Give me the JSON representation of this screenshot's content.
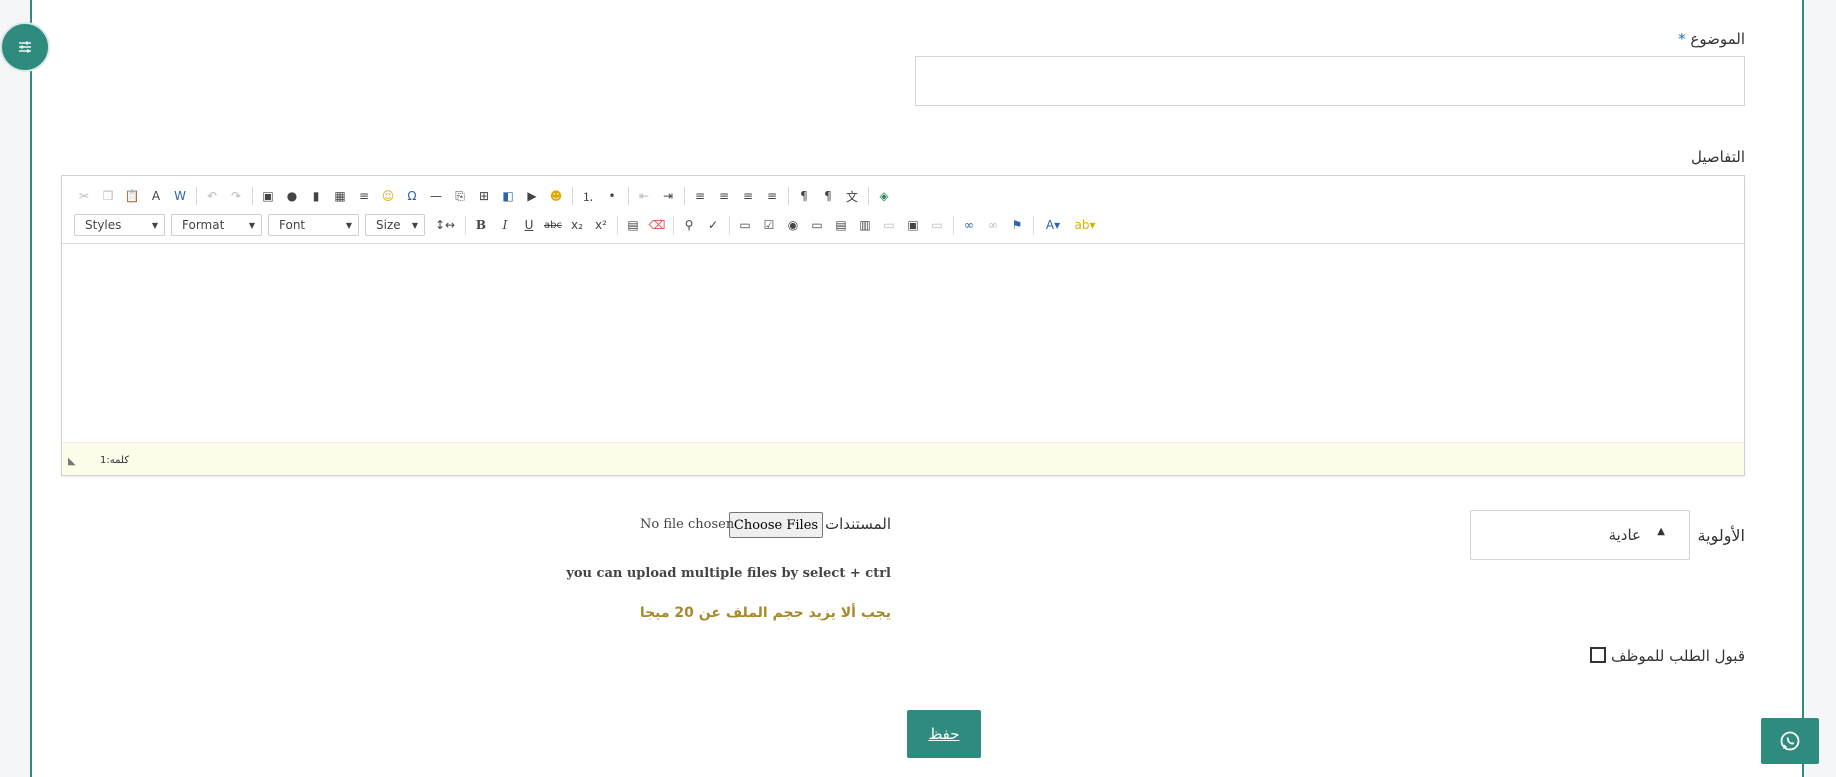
{
  "form": {
    "subject_label": "الموضوع",
    "required_mark": "*",
    "subject_value": "",
    "details_label": "التفاصيل",
    "priority_label": "الأولوية",
    "priority_value": "عادية",
    "documents_label": "المستندات",
    "choose_files_label": "Choose Files",
    "no_file_text": "No file chosen",
    "multi_upload_hint": "you can upload multiple files by select + ctrl",
    "file_size_hint": "يجب ألا يزيد حجم الملف عن 20 ميجا",
    "accept_label": "قبول الطلب للموظف",
    "accept_checked": false,
    "save_label": "حفظ"
  },
  "editor": {
    "combos": [
      "Styles",
      "Format",
      "Font",
      "Size"
    ],
    "word_count": "كلمه:1",
    "toolbar_row1": [
      "cut-icon",
      "copy-icon",
      "paste-icon",
      "paste-text-icon",
      "paste-word-icon",
      "undo-icon",
      "redo-icon",
      "image-icon",
      "spotify-icon",
      "chart-icon",
      "table-icon",
      "text-direction-icon",
      "smiley-icon",
      "special-char-icon",
      "horizontal-rule-icon",
      "page-break-icon",
      "insert-plus-icon",
      "gallery-icon",
      "youtube-icon",
      "emoji-icon",
      "numbered-list-icon",
      "bulleted-list-icon",
      "outdent-icon",
      "indent-icon",
      "align-left-icon",
      "align-center-icon",
      "align-right-icon",
      "align-justify-icon",
      "ltr-icon",
      "rtl-icon",
      "language-icon",
      "map-icon"
    ],
    "toolbar_row2": [
      "line-height-icon",
      "bold-icon",
      "italic-icon",
      "underline-icon",
      "strike-icon",
      "subscript-icon",
      "superscript-icon",
      "pdf-icon",
      "remove-format-icon",
      "find-icon",
      "spellcheck-icon",
      "form-icon",
      "checkbox-icon",
      "radio-icon",
      "textfield-icon",
      "textarea-icon",
      "select-icon",
      "button-icon",
      "image-button-icon",
      "hidden-field-icon",
      "link-icon",
      "unlink-icon",
      "anchor-icon",
      "text-color-icon",
      "bg-color-icon"
    ]
  },
  "colors": {
    "accent": "#2e8b7e",
    "hint_gold": "#a88a2c",
    "required_blue": "#1f6fb2"
  }
}
